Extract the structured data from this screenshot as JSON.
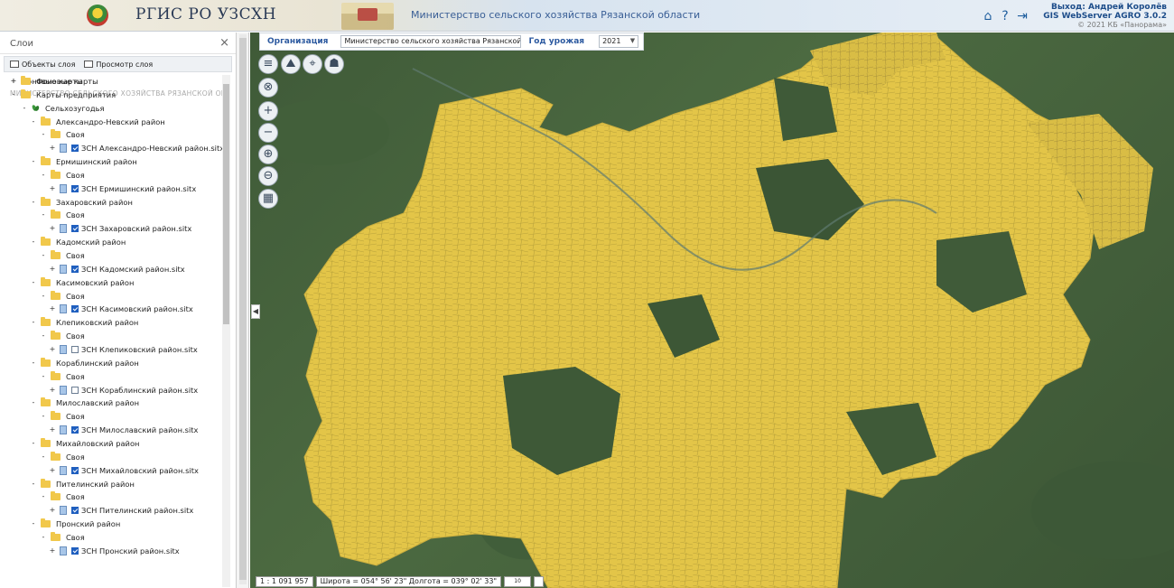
{
  "header": {
    "app_title": "РГИС РО УЗСХН",
    "organization_title": "Министерство сельского хозяйства Рязанской области",
    "logout_label": "Выход: Андрей Королёв",
    "server_label": "GIS WebServer AGRO 3.0.2",
    "copyright": "© 2021 КБ «Панорама»"
  },
  "panel": {
    "title": "Слои",
    "close": "×",
    "tab_objects": "Объекты слоя",
    "tab_view": "Просмотр слоя",
    "org_caption": "МИНИСТЕРСТВО СЕЛЬСКОГО ХОЗЯЙСТВА РЯЗАНСКОЙ ОБЛАСТИ",
    "top_item": "Фоновые карты",
    "tree": {
      "background_maps": "Фоновые карты",
      "enterprise_maps": "Карты предприятия",
      "farmland": "Сельхозугодья",
      "districts": [
        {
          "name": "Александро-Невский район",
          "folder": "Своя",
          "layer": "ЗСН Александро-Невский район.sitx",
          "checked": true
        },
        {
          "name": "Ермишинский район",
          "folder": "Своя",
          "layer": "ЗСН Ермишинский район.sitx",
          "checked": true
        },
        {
          "name": "Захаровский район",
          "folder": "Своя",
          "layer": "ЗСН Захаровский район.sitx",
          "checked": true
        },
        {
          "name": "Кадомский район",
          "folder": "Своя",
          "layer": "ЗСН Кадомский район.sitx",
          "checked": true
        },
        {
          "name": "Касимовский район",
          "folder": "Своя",
          "layer": "ЗСН Касимовский район.sitx",
          "checked": true
        },
        {
          "name": "Клепиковский район",
          "folder": "Своя",
          "layer": "ЗСН Клепиковский район.sitx",
          "checked": false
        },
        {
          "name": "Кораблинский район",
          "folder": "Своя",
          "layer": "ЗСН Кораблинский район.sitx",
          "checked": false
        },
        {
          "name": "Милославский район",
          "folder": "Своя",
          "layer": "ЗСН Милославский район.sitx",
          "checked": true
        },
        {
          "name": "Михайловский район",
          "folder": "Своя",
          "layer": "ЗСН Михайловский район.sitx",
          "checked": true
        },
        {
          "name": "Пителинский район",
          "folder": "Своя",
          "layer": "ЗСН Пителинский район.sitx",
          "checked": true
        },
        {
          "name": "Пронский район",
          "folder": "Своя",
          "layer": "ЗСН Пронский район.sitx",
          "checked": true
        }
      ]
    }
  },
  "toolbar": {
    "org_label": "Организация",
    "org_value": "Министерство сельского хозяйства Рязанской о",
    "year_label": "Год урожая",
    "year_value": "2021"
  },
  "map_buttons": [
    "menu-icon",
    "layers-icon",
    "route-icon",
    "fields-icon",
    "clear-icon",
    "zoom-in-icon",
    "zoom-out-icon",
    "zoom-region-in-icon",
    "zoom-region-out-icon",
    "map-icon"
  ],
  "status": {
    "scale": "1 : 1 091 957",
    "coords": "Широта = 054° 56' 23\" Долгота = 039° 02' 33\"",
    "scalebar": "10 км"
  },
  "colors": {
    "fields": "#e3c548",
    "forest": "#3f5a38",
    "accent": "#2d5aa0"
  }
}
